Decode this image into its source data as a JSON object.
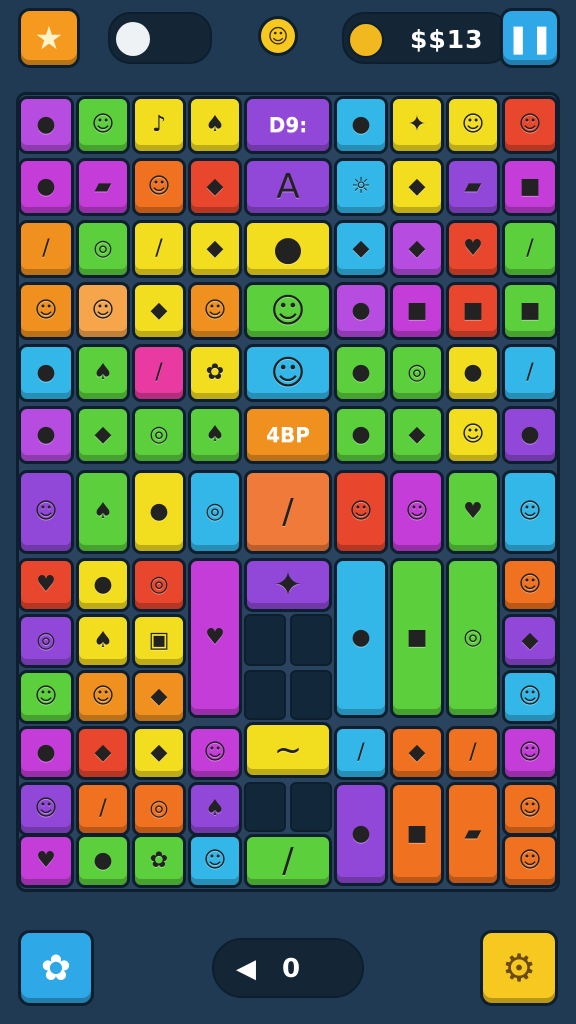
{
  "top_bar": {
    "star_button_icon": "star-icon",
    "egg_counter_icon": "egg-icon",
    "smiley_sun_icon": "sun-face-icon",
    "currency_icon": "gold-coin-icon",
    "currency_value": "$$13",
    "pause_button_icon": "pause-icon"
  },
  "board": {
    "labels": {
      "cell_a": "D9:",
      "cell_b": "A",
      "cell_c": "4BP"
    },
    "rows": [
      [
        {
          "c": "#b64ce0",
          "g": "●"
        },
        {
          "c": "#5bcf3c",
          "g": "☺"
        },
        {
          "c": "#f2dd1f",
          "g": "♪"
        },
        {
          "c": "#f2dd1f",
          "g": "♠"
        },
        {
          "c": "#9148d8",
          "g": "D9:"
        },
        {
          "c": "#32b7e8",
          "g": "●"
        },
        {
          "c": "#f2dd1f",
          "g": "✦"
        },
        {
          "c": "#f2dd1f",
          "g": "☺"
        },
        {
          "c": "#e8472e",
          "g": "☺"
        }
      ],
      [
        {
          "c": "#c43dd8",
          "g": "●"
        },
        {
          "c": "#c43dd8",
          "g": "▰"
        },
        {
          "c": "#f0711f",
          "g": "☺"
        },
        {
          "c": "#e8472e",
          "g": "◆"
        },
        {
          "c": "#9148d8",
          "g": "A"
        },
        {
          "c": "#32b7e8",
          "g": "☼"
        },
        {
          "c": "#f2dd1f",
          "g": "◆"
        },
        {
          "c": "#9148d8",
          "g": "▰"
        },
        {
          "c": "#c43dd8",
          "g": "■"
        }
      ],
      [
        {
          "c": "#f0911f",
          "g": "/"
        },
        {
          "c": "#5bcf3c",
          "g": "◎"
        },
        {
          "c": "#f2dd1f",
          "g": "/"
        },
        {
          "c": "#f2dd1f",
          "g": "◆"
        },
        {
          "c": "#f2dd1f",
          "g": "●"
        },
        {
          "c": "#32b7e8",
          "g": "◆"
        },
        {
          "c": "#b64ce0",
          "g": "◆"
        },
        {
          "c": "#e8472e",
          "g": "♥"
        },
        {
          "c": "#5bcf3c",
          "g": "/"
        }
      ],
      [
        {
          "c": "#f0911f",
          "g": "☺"
        },
        {
          "c": "#f7a54a",
          "g": "☺"
        },
        {
          "c": "#f2dd1f",
          "g": "◆"
        },
        {
          "c": "#f0911f",
          "g": "☺"
        },
        {
          "c": "#5bcf3c",
          "g": "☺"
        },
        {
          "c": "#b64ce0",
          "g": "●"
        },
        {
          "c": "#c43dd8",
          "g": "■"
        },
        {
          "c": "#e8472e",
          "g": "■"
        },
        {
          "c": "#5bcf3c",
          "g": "■"
        }
      ],
      [
        {
          "c": "#32b7e8",
          "g": "●"
        },
        {
          "c": "#5bcf3c",
          "g": "♠"
        },
        {
          "c": "#e83aa0",
          "g": "/"
        },
        {
          "c": "#f2dd1f",
          "g": "✿"
        },
        {
          "c": "#32b7e8",
          "g": "☺"
        },
        {
          "c": "#5bcf3c",
          "g": "●"
        },
        {
          "c": "#5bcf3c",
          "g": "◎"
        },
        {
          "c": "#f2dd1f",
          "g": "●"
        },
        {
          "c": "#32b7e8",
          "g": "/"
        }
      ],
      [
        {
          "c": "#b64ce0",
          "g": "●"
        },
        {
          "c": "#5bcf3c",
          "g": "◆"
        },
        {
          "c": "#5bcf3c",
          "g": "◎"
        },
        {
          "c": "#5bcf3c",
          "g": "♠"
        },
        {
          "c": "#f0911f",
          "g": "4BP"
        },
        {
          "c": "#5bcf3c",
          "g": "●"
        },
        {
          "c": "#5bcf3c",
          "g": "◆"
        },
        {
          "c": "#f2dd1f",
          "g": "☺"
        },
        {
          "c": "#9148d8",
          "g": "●"
        }
      ]
    ]
  },
  "bottom_bar": {
    "hint_button_icon": "puzzle-gear-icon",
    "moves_icon": "speaker-icon",
    "moves_value": "0",
    "settings_button_icon": "gear-icon"
  },
  "colors": {
    "background": "#1f3a52",
    "board": "#2a4460",
    "accent_orange": "#f59a1f",
    "accent_blue": "#2fa8e8",
    "accent_yellow": "#f7c81f"
  }
}
